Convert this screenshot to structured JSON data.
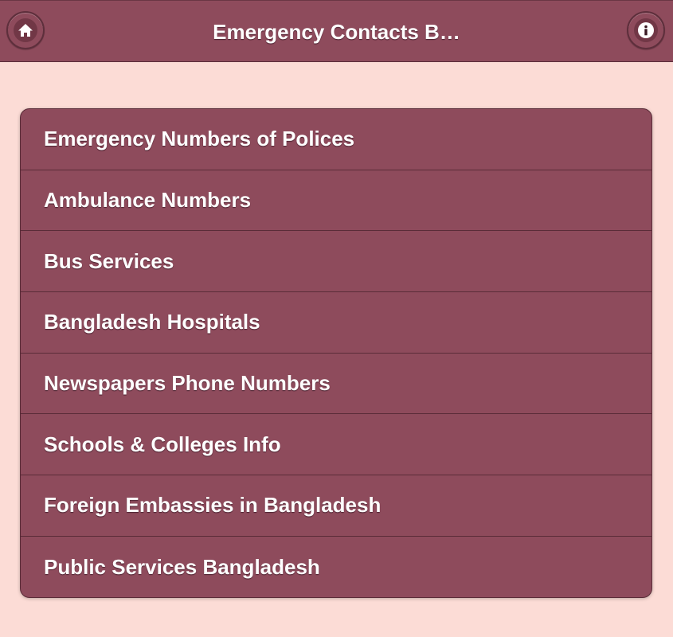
{
  "header": {
    "title": "Emergency Contacts B…",
    "home_icon": "home-icon",
    "info_icon": "info-icon"
  },
  "menu": {
    "items": [
      {
        "label": "Emergency Numbers of Polices"
      },
      {
        "label": "Ambulance Numbers"
      },
      {
        "label": "Bus Services"
      },
      {
        "label": "Bangladesh Hospitals"
      },
      {
        "label": "Newspapers Phone Numbers"
      },
      {
        "label": "Schools & Colleges Info"
      },
      {
        "label": "Foreign Embassies in Bangladesh"
      },
      {
        "label": "Public Services Bangladesh"
      }
    ]
  },
  "colors": {
    "background": "#fcdcd6",
    "bar": "#8e4b5c",
    "text": "#ffffff"
  }
}
